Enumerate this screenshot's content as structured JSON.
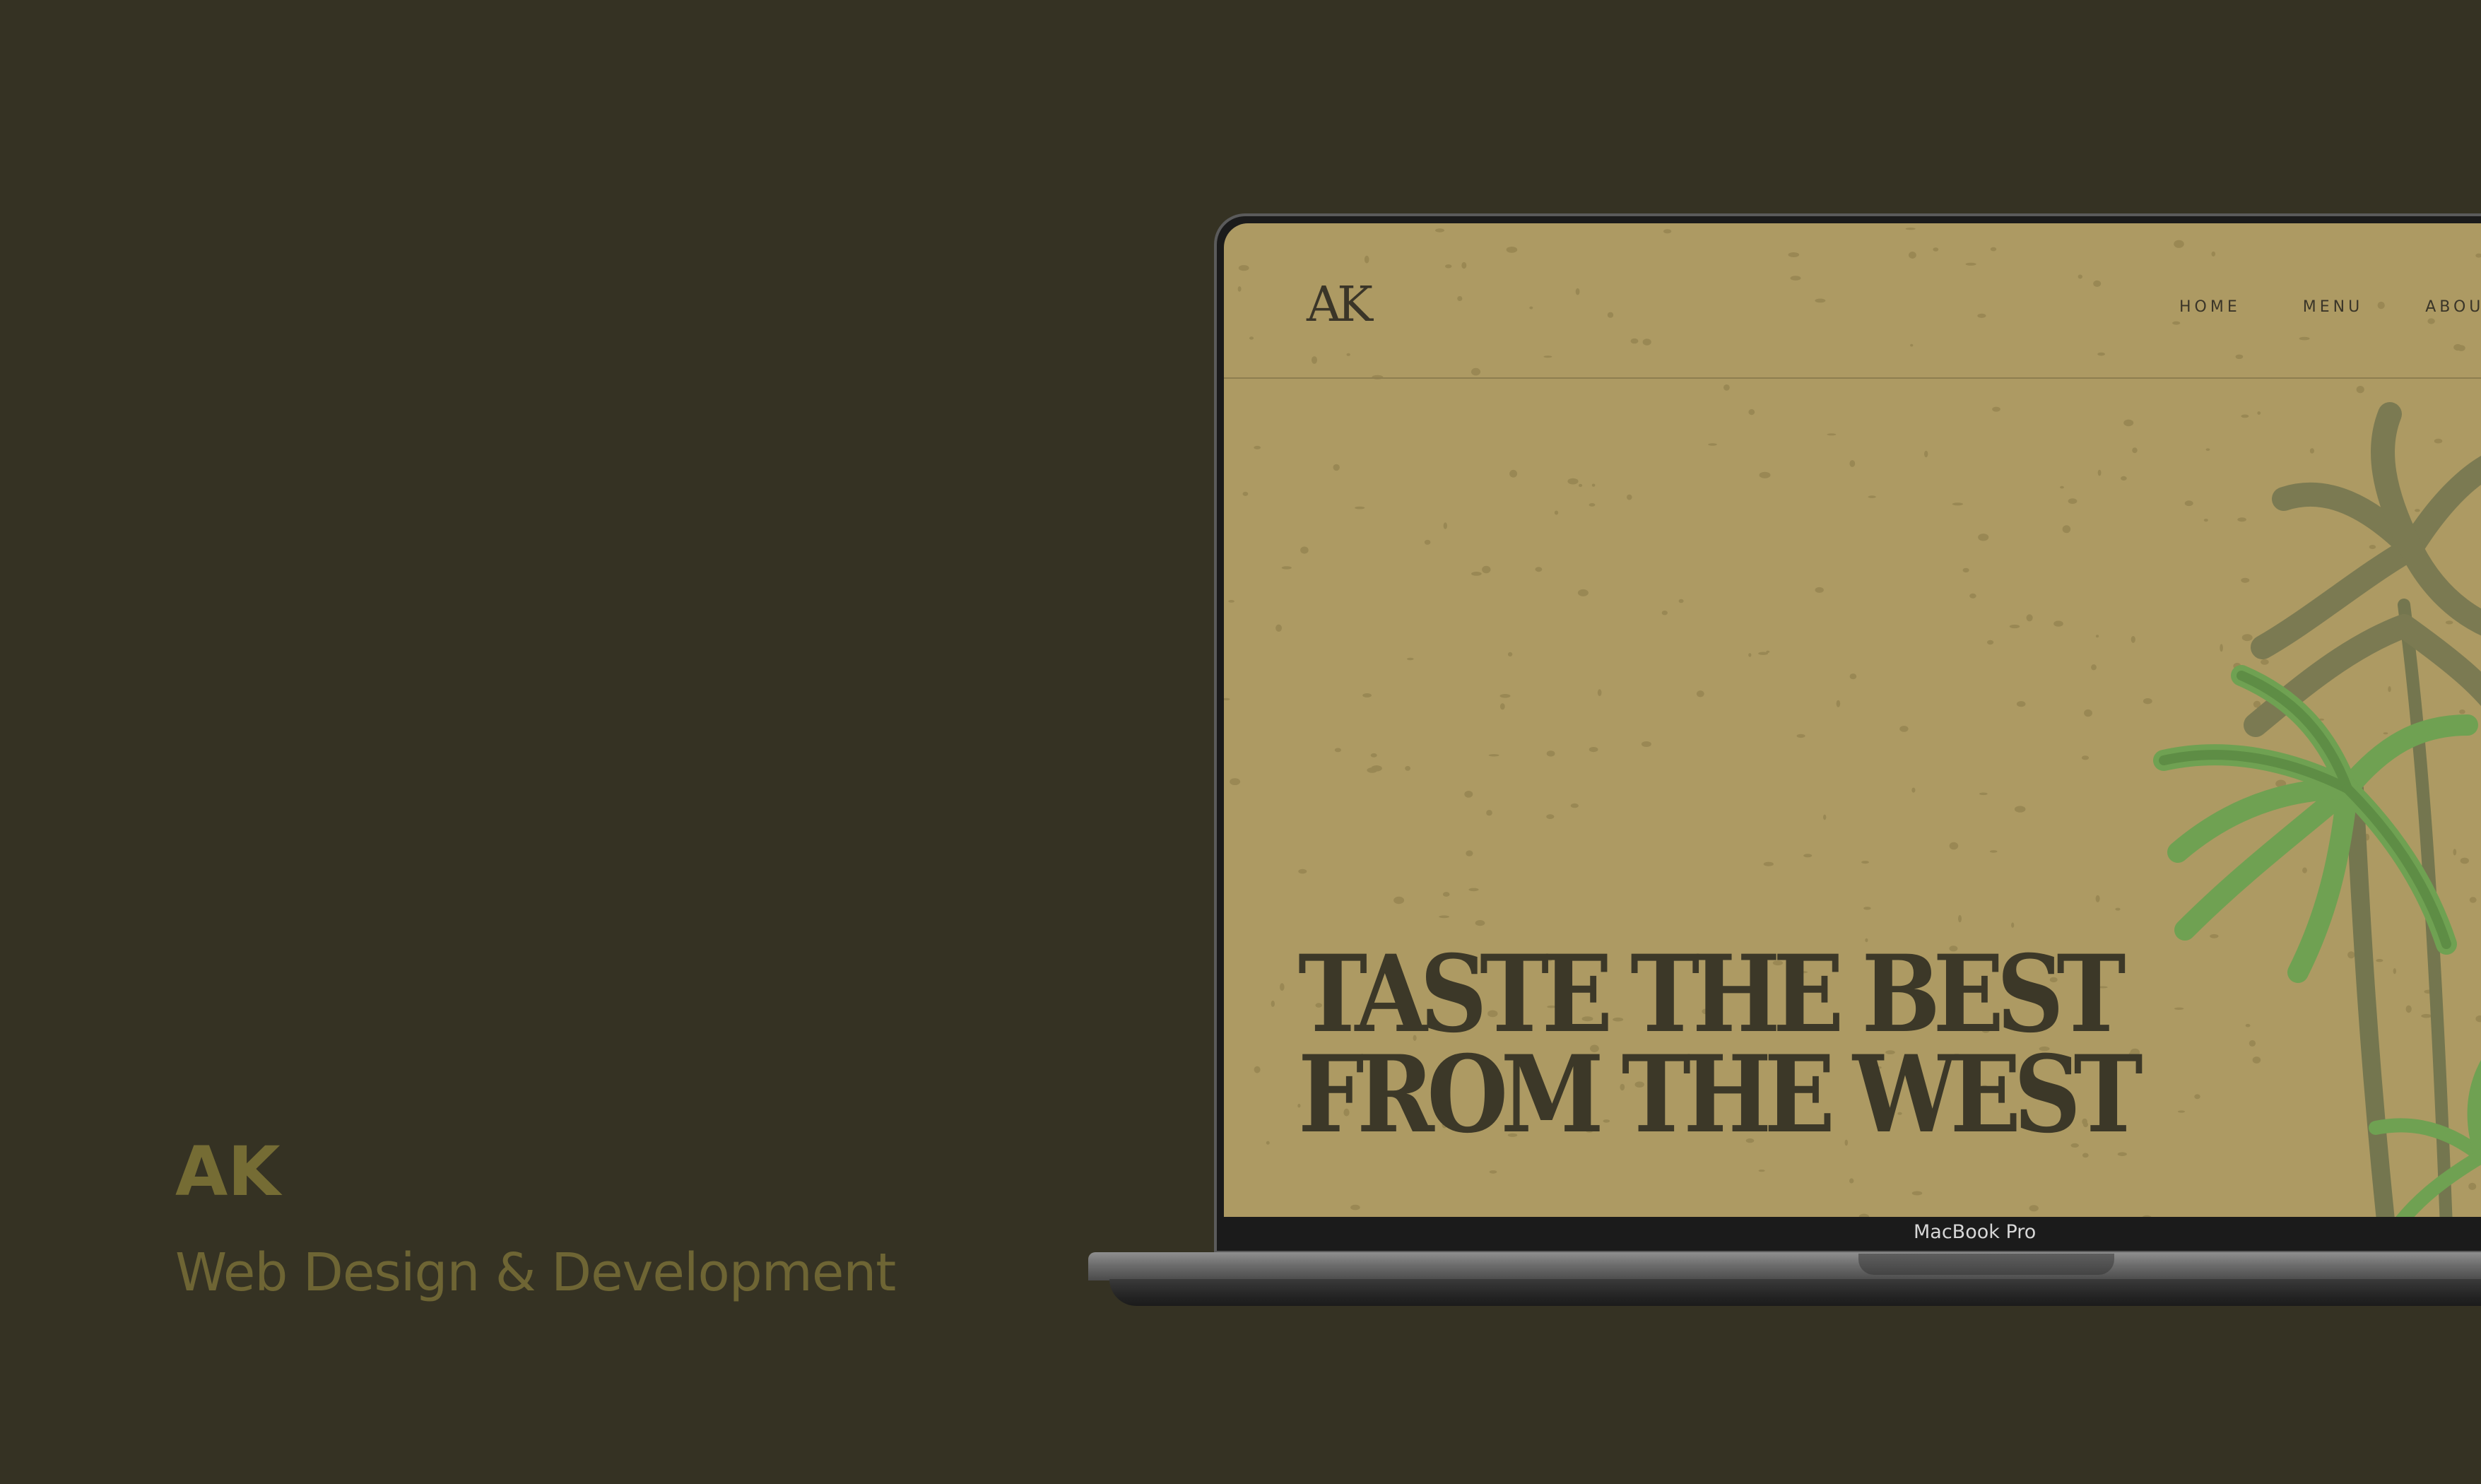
{
  "caption": {
    "title": "AK",
    "subtitle": "Web Design & Development"
  },
  "site": {
    "logo": "AK",
    "nav": [
      "HOME",
      "MENU",
      "ABOUT"
    ],
    "headline_line1": "TASTE THE BEST",
    "headline_line2": "FROM THE WEST",
    "palm_icon": "palm-tree-illustration"
  },
  "device": {
    "label": "MacBook Pro"
  },
  "colors": {
    "page_background": "#353223",
    "caption": "#756c34",
    "site_background": "#ad9a63",
    "site_text": "#3a3528",
    "palm_green": "#6fa152",
    "palm_shadow": "#7d7a55"
  }
}
